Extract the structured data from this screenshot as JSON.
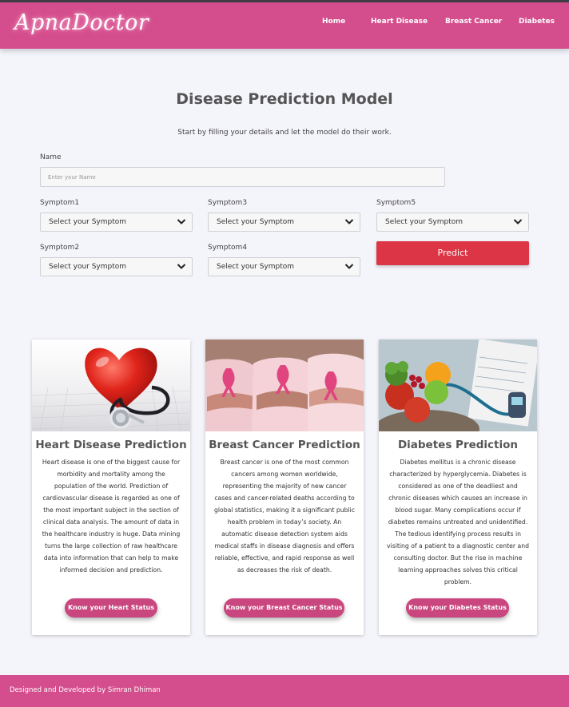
{
  "brand": {
    "logo": "ApnaDoctor",
    "color": "#d44d8c"
  },
  "nav": [
    {
      "label": "Home"
    },
    {
      "label": "Heart Disease"
    },
    {
      "label": "Breast Cancer"
    },
    {
      "label": "Diabetes"
    }
  ],
  "hero": {
    "title": "Disease Prediction Model",
    "subtitle": "Start by filling your details and let the model do their work."
  },
  "form": {
    "name_label": "Name",
    "name_placeholder": "Enter your Name",
    "symptoms": [
      {
        "label": "Symptom1",
        "value": "Select your Symptom"
      },
      {
        "label": "Symptom2",
        "value": "Select your Symptom"
      },
      {
        "label": "Symptom3",
        "value": "Select your Symptom"
      },
      {
        "label": "Symptom4",
        "value": "Select your Symptom"
      },
      {
        "label": "Symptom5",
        "value": "Select your Symptom"
      }
    ],
    "predict_label": "Predict",
    "predict_color": "#dc3545"
  },
  "cards": [
    {
      "image": "heart-stethoscope-image",
      "title": "Heart Disease Prediction",
      "text": "Heart disease is one of the biggest cause for morbidity and mortality among the population of the world. Prediction of cardiovascular disease is regarded as one of the most important subject in the section of clinical data analysis. The amount of data in the healthcare industry is huge. Data mining turns the large collection of raw healthcare data into information that can help to make informed decision and prediction.",
      "button": "Know your Heart Status"
    },
    {
      "image": "breast-cancer-ribbon-image",
      "title": "Breast Cancer Prediction",
      "text": "Breast cancer is one of the most common cancers among women worldwide, representing the majority of new cancer cases and cancer-related deaths according to global statistics, making it a significant public health problem in today’s society. An automatic disease detection system aids medical staffs in disease diagnosis and offers reliable, effective, and rapid response as well as decreases the risk of death.",
      "button": "Know your Breast Cancer Status"
    },
    {
      "image": "diabetes-fruit-glucometer-image",
      "title": "Diabetes Prediction",
      "text": "Diabetes mellitus is a chronic disease characterized by hyperglycemia. Diabetes is considered as one of the deadliest and chronic diseases which causes an increase in blood sugar. Many complications occur if diabetes remains untreated and unidentified. The tedious identifying process results in visiting of a patient to a diagnostic center and consulting doctor. But the rise in machine learning approaches solves this critical problem.",
      "button": "Know your Diabetes Status"
    }
  ],
  "footer": {
    "text": "Designed and Developed by Simran Dhiman"
  }
}
